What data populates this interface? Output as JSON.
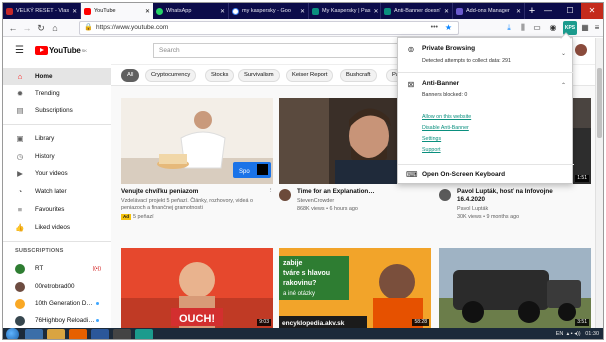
{
  "browser": {
    "tabs": [
      {
        "label": "VELKÝ RESET - Vlas",
        "color": "#c62828"
      },
      {
        "label": "YouTube",
        "color": "#ff0000"
      },
      {
        "label": "WhatsApp",
        "color": "#25d366"
      },
      {
        "label": "my kaspersky - Goo",
        "color": "#4285f4"
      },
      {
        "label": "My Kaspersky | Pas",
        "color": "#0a8f7e"
      },
      {
        "label": "Anti-Banner doesn'",
        "color": "#0a8f7e"
      },
      {
        "label": "Add-ons Manager",
        "color": "#6a5acd"
      }
    ],
    "url": "https://www.youtube.com",
    "kaspersky_badge": "KPS"
  },
  "youtube": {
    "logo_text": "YouTube",
    "logo_region": "SK",
    "search_placeholder": "Search",
    "sidebar": {
      "primary": [
        {
          "label": "Home",
          "icon": "home-icon",
          "glyph": "⌂"
        },
        {
          "label": "Trending",
          "icon": "fire-icon",
          "glyph": "✹"
        },
        {
          "label": "Subscriptions",
          "icon": "subscriptions-icon",
          "glyph": "▤"
        }
      ],
      "library": [
        {
          "label": "Library",
          "icon": "library-icon",
          "glyph": "▣"
        },
        {
          "label": "History",
          "icon": "history-icon",
          "glyph": "◷"
        },
        {
          "label": "Your videos",
          "icon": "your-videos-icon",
          "glyph": "▶"
        },
        {
          "label": "Watch later",
          "icon": "clock-icon",
          "glyph": "◔"
        },
        {
          "label": "Favourites",
          "icon": "playlist-icon",
          "glyph": "≡"
        },
        {
          "label": "Liked videos",
          "icon": "thumbs-up-icon",
          "glyph": "👍"
        }
      ],
      "subscriptions_heading": "SUBSCRIPTIONS",
      "subscriptions": [
        {
          "label": "RT",
          "color": "#2e7d32"
        },
        {
          "label": "00retrobrad00",
          "color": "#6d4c41"
        },
        {
          "label": "10th Generation D…",
          "color": "#f9a825"
        },
        {
          "label": "76Highboy Reloadi…",
          "color": "#37474f"
        }
      ]
    },
    "chips": [
      "All",
      "Cryptocurrency",
      "Stocks",
      "Survivalism",
      "Keiser Report",
      "Bushcraft",
      "Pa"
    ],
    "videos": [
      {
        "title": "Venujte chvíľku peniazom",
        "desc": "Vzdelávací projekt 5 peňazí. Články, rozhovory, videá o peniazoch a finančnej gramotnosti",
        "ad_badge": "Ad",
        "channel": "5 peňazí"
      },
      {
        "title": "Time for an Explanation…",
        "channel": "StevenCrowder",
        "stats": "868K views • 6 hours ago"
      },
      {
        "title_l1": "Pavol Lupták, hosť na Infovojne",
        "title_l2": "16.4.2020",
        "channel": "Pavol Lupták",
        "stats": "30K views • 9 months ago",
        "duration": "1:51"
      },
      {
        "duration": "9:03",
        "overlay": "OUCH!"
      },
      {
        "duration": "58:28",
        "overlay_l1": "zabije",
        "overlay_l2": "tváre s hlavou",
        "overlay_l3": "rakovinu?",
        "overlay_l4": "a iné otázky",
        "overlay_l5": "encyklopedia.akv.sk"
      },
      {
        "duration": "3:51"
      }
    ]
  },
  "kaspersky_popup": {
    "private_browsing": {
      "title": "Private Browsing",
      "subtitle": "Detected attempts to collect data: 291"
    },
    "anti_banner": {
      "title": "Anti-Banner",
      "subtitle": "Banners blocked: 0",
      "links": [
        "Allow on this website",
        "Disable Anti-Banner",
        "Settings",
        "Support"
      ]
    },
    "keyboard": {
      "title": "Open On-Screen Keyboard"
    }
  },
  "taskbar": {
    "lang": "EN",
    "time": "01:30"
  }
}
